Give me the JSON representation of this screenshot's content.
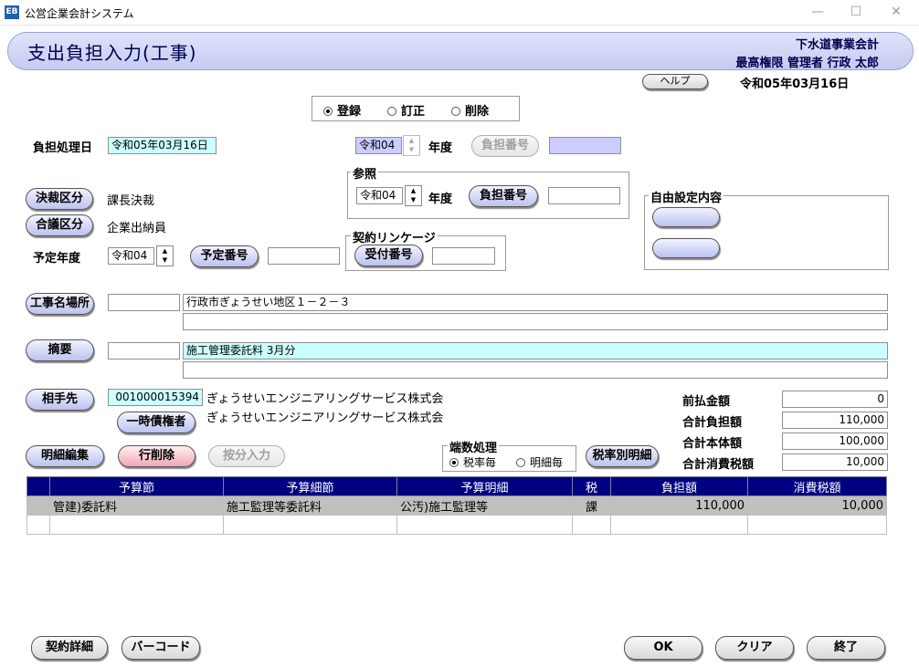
{
  "window": {
    "title": "公営企業会計システム",
    "icon_text": "EB",
    "minimize": "—",
    "maximize": "☐",
    "close": "✕"
  },
  "header": {
    "title": "支出負担入力(工事)",
    "org": "下水道事業会計",
    "user": "最高権限 管理者 行政 太郎",
    "date": "令和05年03月16日",
    "help": "ヘルプ"
  },
  "mode": {
    "options": [
      "登録",
      "訂正",
      "削除"
    ],
    "selected": 0
  },
  "burden_date": {
    "label": "負担処理日",
    "value": "令和05年03月16日"
  },
  "top_year": {
    "value": "令和04",
    "label": "年度",
    "button": "負担番号",
    "number": ""
  },
  "reference": {
    "title": "参照",
    "year": "令和04",
    "year_label": "年度",
    "button": "負担番号",
    "number": ""
  },
  "custom": {
    "title": "自由設定内容"
  },
  "approval": {
    "button": "決裁区分",
    "value": "課長決裁"
  },
  "agreement": {
    "button": "合議区分",
    "value": "企業出納員"
  },
  "planned": {
    "label": "予定年度",
    "year": "令和04",
    "button": "予定番号",
    "number": ""
  },
  "contract_link": {
    "title": "契約リンケージ",
    "button": "受付番号",
    "number": ""
  },
  "project": {
    "button": "工事名場所",
    "code": "",
    "line1": "行政市ぎょうせい地区１－２－３",
    "line2": ""
  },
  "summary": {
    "button": "摘要",
    "code": "",
    "line1": "施工管理委託料 3月分",
    "line2": ""
  },
  "partner": {
    "button": "相手先",
    "code": "001000015394",
    "name": "ぎょうせいエンジニアリングサービス株式会",
    "temp_button": "一時債権者",
    "temp_name": "ぎょうせいエンジニアリングサービス株式会"
  },
  "amounts": [
    {
      "label": "前払金額",
      "value": "0"
    },
    {
      "label": "合計負担額",
      "value": "110,000"
    },
    {
      "label": "合計本体額",
      "value": "100,000"
    },
    {
      "label": "合計消費税額",
      "value": "10,000"
    }
  ],
  "actions": {
    "detail_edit": "明細編集",
    "row_delete": "行削除",
    "allocate": "按分入力",
    "tax_detail": "税率別明細"
  },
  "rounding": {
    "title": "端数処理",
    "options": [
      "税率毎",
      "明細毎"
    ],
    "selected": 0
  },
  "grid": {
    "columns": [
      "",
      "予算節",
      "予算細節",
      "予算明細",
      "税",
      "負担額",
      "消費税額"
    ],
    "rows": [
      [
        "",
        "管建)委託料",
        "施工監理等委託料",
        "公汚)施工監理等",
        "課",
        "110,000",
        "10,000"
      ],
      [
        "",
        "",
        "",
        "",
        "",
        "",
        ""
      ]
    ]
  },
  "footer": {
    "contract_detail": "契約詳細",
    "barcode": "バーコード",
    "ok": "OK",
    "clear": "クリア",
    "exit": "終了"
  }
}
